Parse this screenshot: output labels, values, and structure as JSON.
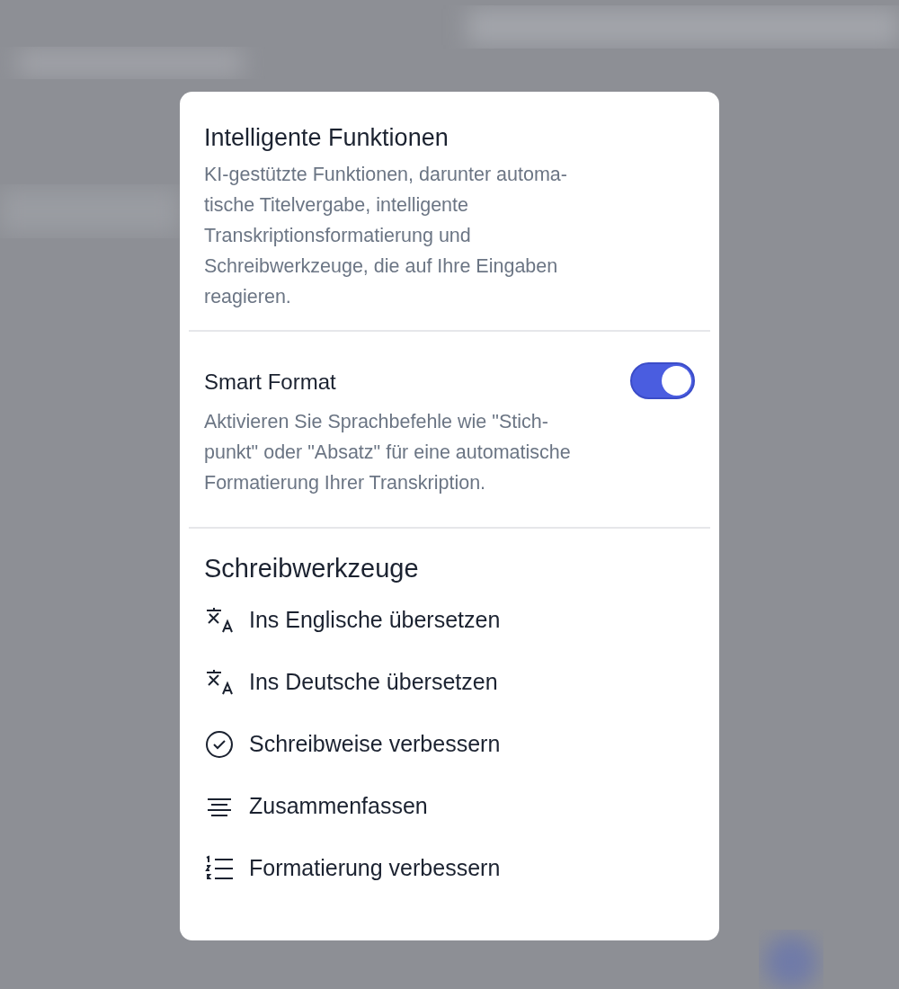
{
  "intro": {
    "title": "Intelligente Funktionen",
    "description_lines": [
      "KI-gestützte Funktionen, darunter automa-",
      "tische Titelvergabe, intelligente",
      "Transkriptionsformatierung und",
      "Schreibwerkzeuge, die auf Ihre Eingaben",
      "reagieren."
    ]
  },
  "smart_format": {
    "label": "Smart Format",
    "on": true,
    "description_lines": [
      "Aktivieren Sie Sprachbefehle wie \"Stich-",
      "punkt\" oder \"Absatz\" für eine automatische",
      "Formatierung Ihrer Transkription."
    ]
  },
  "writing_tools": {
    "title": "Schreibwerkzeuge",
    "items": [
      {
        "kind": "translate",
        "label": "Ins Englische übersetzen"
      },
      {
        "kind": "translate",
        "label": "Ins Deutsche übersetzen"
      },
      {
        "kind": "check",
        "label": "Schreibweise verbessern"
      },
      {
        "kind": "summary",
        "label": "Zusammenfassen"
      },
      {
        "kind": "numbered",
        "label": "Formatierung verbessern"
      }
    ]
  }
}
